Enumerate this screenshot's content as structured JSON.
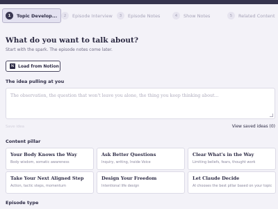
{
  "steps": [
    {
      "num": "1",
      "label": "Topic Develop..."
    },
    {
      "num": "2",
      "label": "Episode Interview"
    },
    {
      "num": "3",
      "label": "Episode Notes"
    },
    {
      "num": "4",
      "label": "Show Notes"
    },
    {
      "num": "5",
      "label": "Related Content"
    }
  ],
  "header": {
    "title": "What do you want to talk about?",
    "subtitle": "Start with the spark. The episode notes come later."
  },
  "notion_button": {
    "icon": "N",
    "label": "Load from Notion"
  },
  "idea": {
    "label": "The idea pulling at you",
    "placeholder": "The observation, the question that won't leave you alone, the thing you keep thinking about...",
    "save_label": "Save idea",
    "view_saved": "View saved ideas (0)"
  },
  "pillar": {
    "label": "Content pillar",
    "cards": [
      {
        "title": "Your Body Knows the Way",
        "sub": "Body wisdom, somatic awareness"
      },
      {
        "title": "Ask Better Questions",
        "sub": "Inquiry, writing, Inside Voice"
      },
      {
        "title": "Clear What's in the Way",
        "sub": "Limiting beliefs, fears, thought work"
      },
      {
        "title": "Take Your Next Aligned Step",
        "sub": "Action, tactic steps, momentum"
      },
      {
        "title": "Design Your Freedom",
        "sub": "Intentional life design"
      },
      {
        "title": "Let Claude Decide",
        "sub": "AI chooses the best pillar based on your topic"
      }
    ]
  },
  "episode_type": {
    "label": "Episode type"
  },
  "colors": {
    "topbar": "#36344e",
    "background": "#f3f2f8",
    "active_step": "#e3e1f0"
  }
}
